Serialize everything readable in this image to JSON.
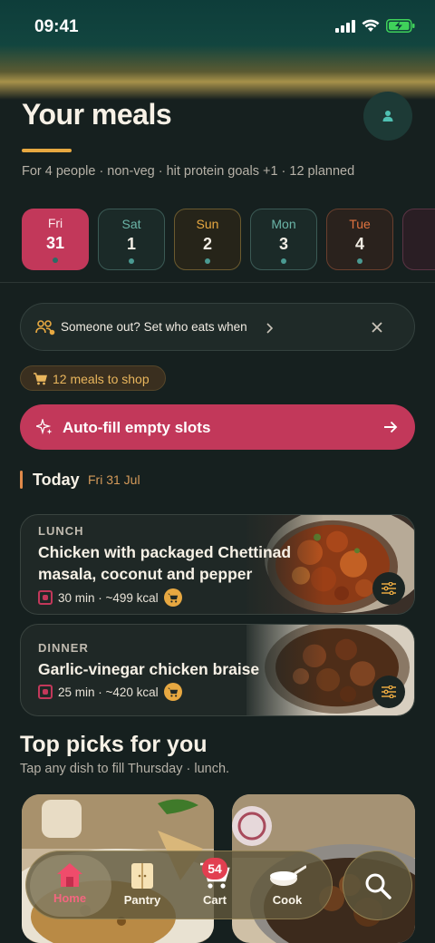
{
  "status": {
    "time": "09:41"
  },
  "header": {
    "title": "Your meals",
    "subtitle": "For 4 people · non-veg · hit protein goals +1 · 12 planned"
  },
  "days": [
    {
      "name": "Fri",
      "num": "31",
      "selected": true
    },
    {
      "name": "Sat",
      "num": "1"
    },
    {
      "name": "Sun",
      "num": "2"
    },
    {
      "name": "Mon",
      "num": "3"
    },
    {
      "name": "Tue",
      "num": "4"
    }
  ],
  "banner": {
    "text": "Someone out? Set who eats when"
  },
  "shop_pill": {
    "label": "12 meals to shop"
  },
  "autofill": {
    "label": "Auto-fill empty slots"
  },
  "today": {
    "label": "Today",
    "date": "Fri 31 Jul"
  },
  "meals": [
    {
      "type": "LUNCH",
      "title_line1": "Chicken with packaged Chettinad",
      "title_line2": "masala, coconut and pepper",
      "meta": "30 min · ~499 kcal"
    },
    {
      "type": "DINNER",
      "title_line1": "Garlic-vinegar chicken braise",
      "meta": "25 min · ~420 kcal"
    }
  ],
  "top_picks": {
    "title": "Top picks for you",
    "subtitle": "Tap any dish to fill Thursday · lunch."
  },
  "nav": {
    "items": [
      "Home",
      "Pantry",
      "Cart",
      "Cook"
    ],
    "cart_count": "54"
  },
  "colors": {
    "background": "#16201f",
    "accent_pink": "#c2385a",
    "accent_gold": "#e7a841",
    "teal": "#4a9a92"
  },
  "icons": [
    "signal-icon",
    "wifi-icon",
    "battery-charging-icon",
    "person-icon",
    "people-icon",
    "chevron-right-icon",
    "close-icon",
    "cart-icon",
    "sparkle-icon",
    "arrow-right-icon",
    "non-veg-icon",
    "tune-icon",
    "home-icon",
    "pantry-icon",
    "cook-pot-icon",
    "search-icon"
  ]
}
